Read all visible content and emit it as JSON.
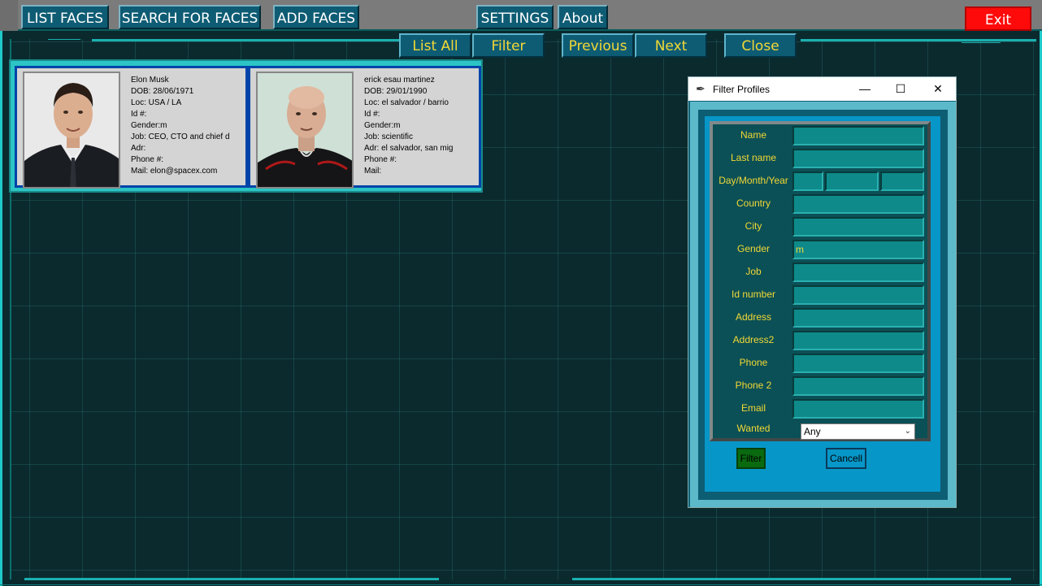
{
  "menu": {
    "list_faces": "LIST FACES",
    "search_faces": "SEARCH FOR FACES",
    "add_faces": "ADD FACES",
    "settings": "SETTINGS",
    "about": "About",
    "exit": "Exit"
  },
  "nav": {
    "list_all": "List All",
    "filter": "Filter",
    "previous": "Previous",
    "next": "Next",
    "close": "Close"
  },
  "profiles": [
    {
      "name": "Elon Musk",
      "dob": "DOB: 28/06/1971",
      "loc": "Loc: USA / LA",
      "id": "Id #:",
      "gender": "Gender:m",
      "job": "Job: CEO, CTO and chief d",
      "adr": "Adr:",
      "phone": "Phone #:",
      "mail": "Mail: elon@spacex.com"
    },
    {
      "name": "erick esau martinez",
      "dob": "DOB: 29/01/1990",
      "loc": "Loc: el salvador / barrio",
      "id": "Id #:",
      "gender": "Gender:m",
      "job": "Job: scientific",
      "adr": "Adr: el salvador, san mig",
      "phone": "Phone #:",
      "mail": "Mail:"
    }
  ],
  "dialog": {
    "title": "Filter Profiles",
    "fields": {
      "name": "Name",
      "last_name": "Last name",
      "dmy": "Day/Month/Year",
      "country": "Country",
      "city": "City",
      "gender": "Gender",
      "job": "Job",
      "id_number": "Id number",
      "address": "Address",
      "address2": "Address2",
      "phone": "Phone",
      "phone2": "Phone 2",
      "email": "Email",
      "wanted": "Wanted"
    },
    "values": {
      "gender": "m",
      "wanted": "Any"
    },
    "filter_btn": "Filter",
    "cancel_btn": "Cancell"
  },
  "colors": {
    "accent": "#1fc9c9",
    "button_bg": "#0e5c74",
    "label_yellow": "#f2d835",
    "exit_red": "#ff0a0a"
  }
}
